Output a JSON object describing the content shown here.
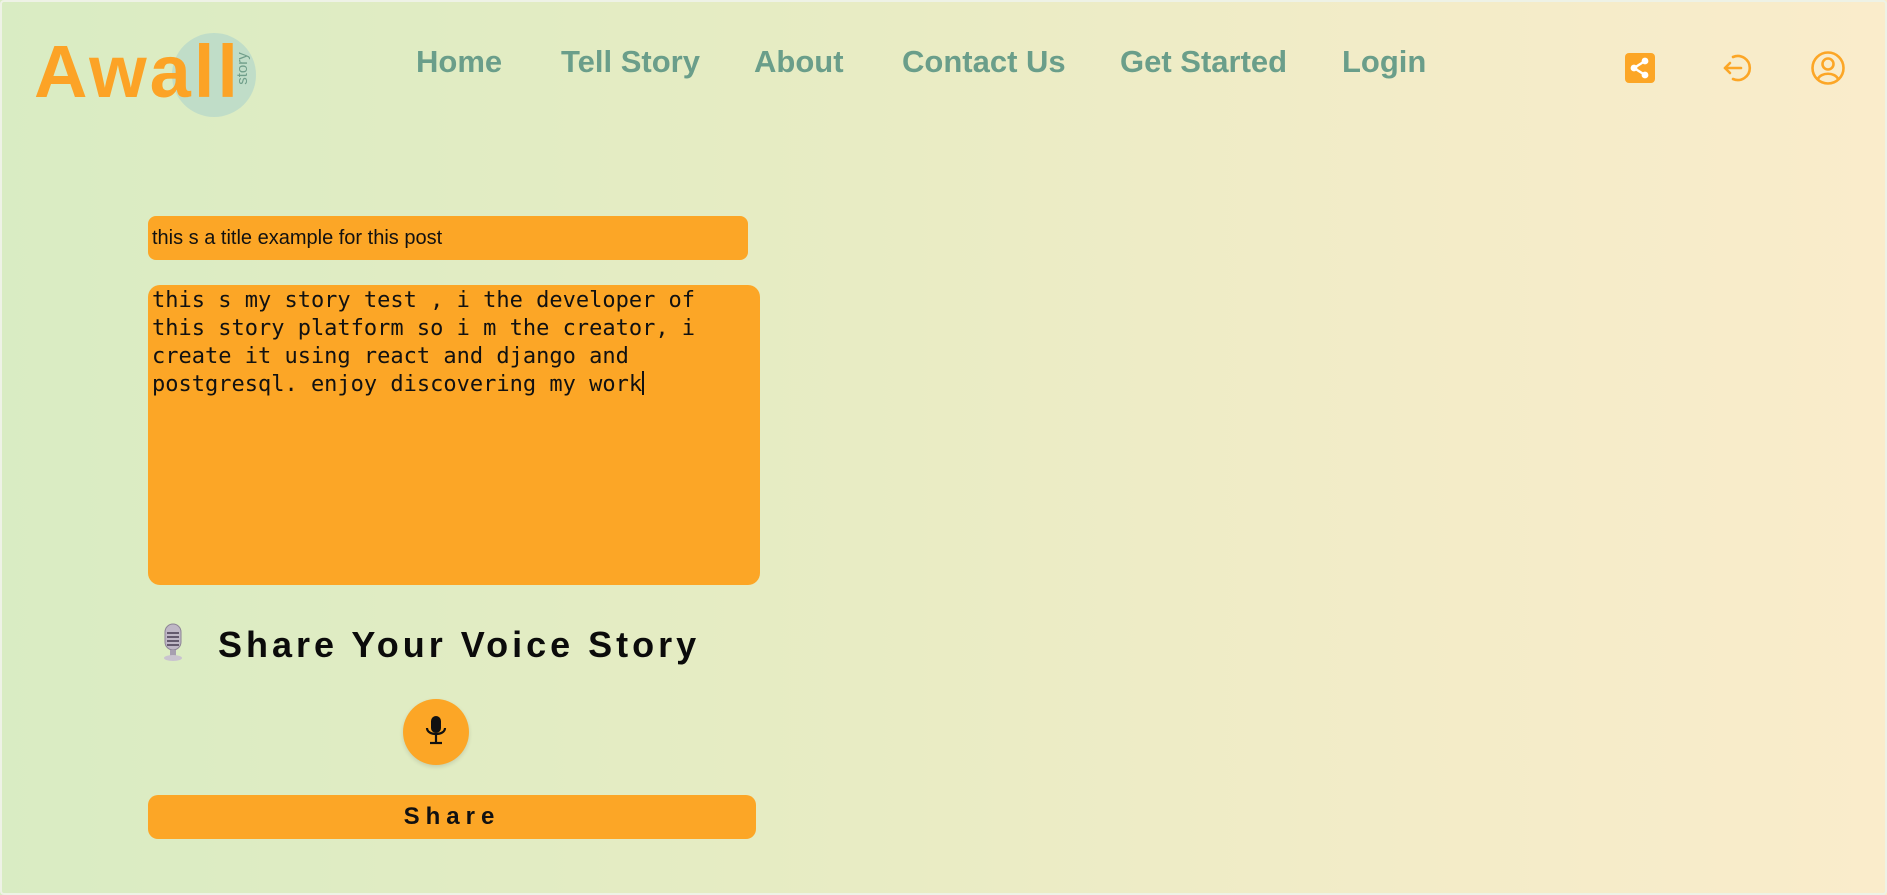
{
  "logo": {
    "text": "Awall",
    "subtext": "story"
  },
  "nav": {
    "items": [
      {
        "label": "Home"
      },
      {
        "label": "Tell Story"
      },
      {
        "label": "About"
      },
      {
        "label": "Contact Us"
      },
      {
        "label": "Get Started"
      },
      {
        "label": "Login"
      }
    ]
  },
  "header_icons": [
    "share-icon",
    "logout-icon",
    "user-profile-icon"
  ],
  "form": {
    "title_value": "this s a title example for this post",
    "story_value": "this s my story test , i the developer of\nthis story platform so i m the creator, i\ncreate it using react and django and\npostgresql. enjoy discovering my work",
    "voice_heading": "Share Your Voice Story",
    "share_label": "Share"
  },
  "colors": {
    "accent": "#fca626",
    "nav_text": "#6a9e8a",
    "logo_circle": "#bcdcc9"
  }
}
